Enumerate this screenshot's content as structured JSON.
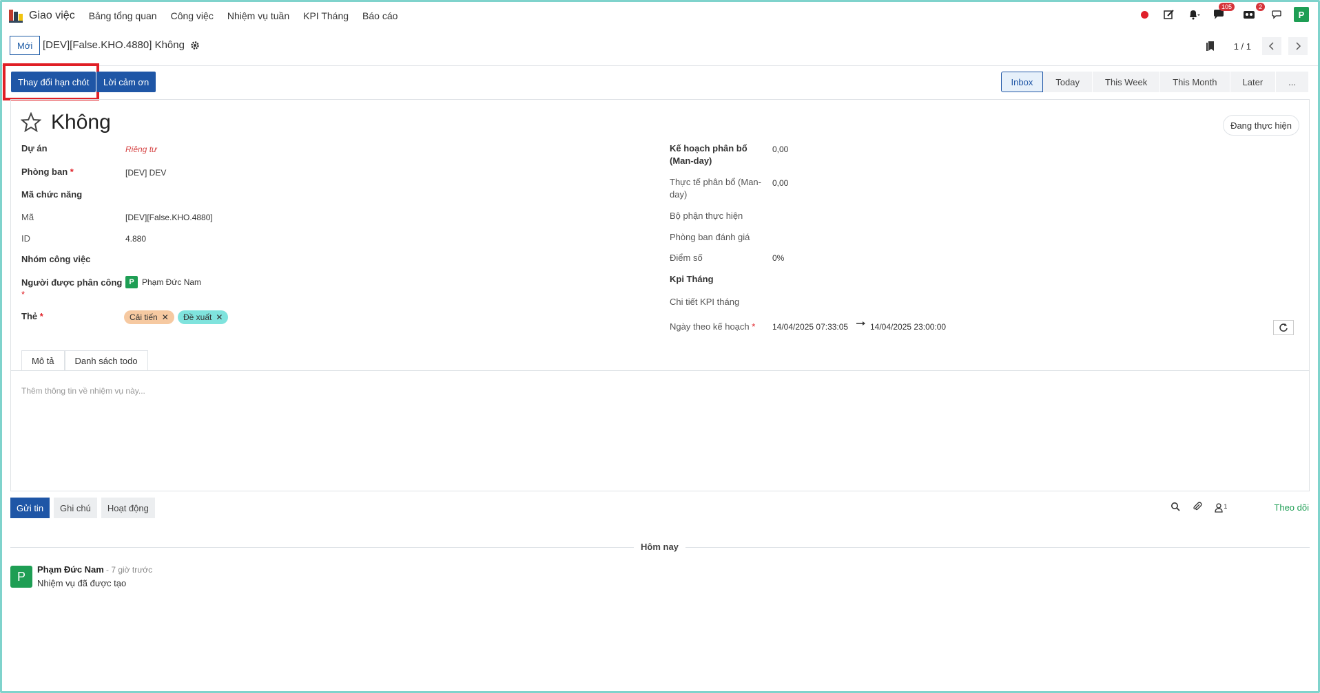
{
  "nav": {
    "app_name": "Giao việc",
    "menu": [
      "Bảng tổng quan",
      "Công việc",
      "Nhiệm vụ tuần",
      "KPI Tháng",
      "Báo cáo"
    ],
    "chat_badge": "105",
    "activity_badge": "2",
    "user_initial": "P"
  },
  "control": {
    "new_label": "Mới",
    "breadcrumb": "[DEV][False.KHO.4880] Không",
    "pager": "1 / 1"
  },
  "actions": {
    "change_deadline": "Thay đổi hạn chót",
    "thanks": "Lời cảm ơn"
  },
  "stages": [
    "Inbox",
    "Today",
    "This Week",
    "This Month",
    "Later",
    "..."
  ],
  "form": {
    "title": "Không",
    "state": "Đang thực hiện",
    "left": {
      "project_label": "Dự án",
      "project_value": "Riêng tư",
      "dept_label": "Phòng ban",
      "dept_value": "[DEV] DEV",
      "func_code_label": "Mã chức năng",
      "code_label": "Mã",
      "code_value": "[DEV][False.KHO.4880]",
      "id_label": "ID",
      "id_value": "4.880",
      "group_label": "Nhóm công việc",
      "assignee_label": "Người được phân công",
      "assignee_value": "Phạm Đức Nam",
      "assignee_initial": "P",
      "tags_label": "Thẻ",
      "tags": [
        "Cải tiến",
        "Đề xuất"
      ]
    },
    "right": {
      "planned_label_1": "Kế hoạch phân bổ",
      "planned_label_2": "(Man-day)",
      "planned_value": "0,00",
      "actual_label_1": "Thực tế phân bổ (Man-",
      "actual_label_2": "day)",
      "actual_value": "0,00",
      "exec_dept_label": "Bộ phận thực hiện",
      "eval_dept_label": "Phòng ban đánh giá",
      "score_label": "Điểm số",
      "score_value": "0%",
      "kpi_label": "Kpi Tháng",
      "kpi_detail_label": "Chi tiết KPI tháng",
      "plan_date_label": "Ngày theo kế hoạch",
      "plan_date_start": "14/04/2025 07:33:05",
      "plan_date_end": "14/04/2025 23:00:00"
    },
    "tabs": [
      "Mô tả",
      "Danh sách todo"
    ],
    "description_placeholder": "Thêm thông tin về nhiệm vụ này..."
  },
  "chatter": {
    "send": "Gửi tin",
    "note": "Ghi chú",
    "activity": "Hoạt động",
    "followers_count": "1",
    "follow": "Theo dõi",
    "date_sep": "Hôm nay",
    "message": {
      "initial": "P",
      "author": "Phạm Đức Nam",
      "time": "- 7 giờ trước",
      "body": "Nhiệm vụ đã được tạo"
    }
  }
}
